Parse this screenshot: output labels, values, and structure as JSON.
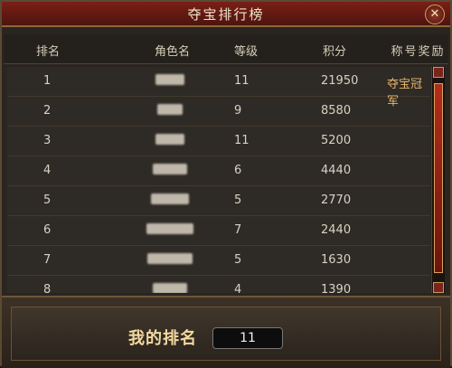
{
  "window": {
    "title": "夺宝排行榜"
  },
  "table": {
    "headers": [
      "排名",
      "角色名",
      "等级",
      "积分",
      "称号奖励"
    ],
    "rows": [
      {
        "rank": "1",
        "level": "11",
        "score": "21950",
        "title": "夺宝冠军"
      },
      {
        "rank": "2",
        "level": "9",
        "score": "8580",
        "title": ""
      },
      {
        "rank": "3",
        "level": "11",
        "score": "5200",
        "title": ""
      },
      {
        "rank": "4",
        "level": "6",
        "score": "4440",
        "title": ""
      },
      {
        "rank": "5",
        "level": "5",
        "score": "2770",
        "title": ""
      },
      {
        "rank": "6",
        "level": "7",
        "score": "2440",
        "title": ""
      },
      {
        "rank": "7",
        "level": "5",
        "score": "1630",
        "title": ""
      },
      {
        "rank": "8",
        "level": "4",
        "score": "1390",
        "title": ""
      }
    ]
  },
  "my_rank": {
    "label": "我的排名",
    "value": "11"
  },
  "colors": {
    "titlebar": "#7a1f16",
    "accent": "#e7b76b",
    "panel": "#2a2520"
  }
}
